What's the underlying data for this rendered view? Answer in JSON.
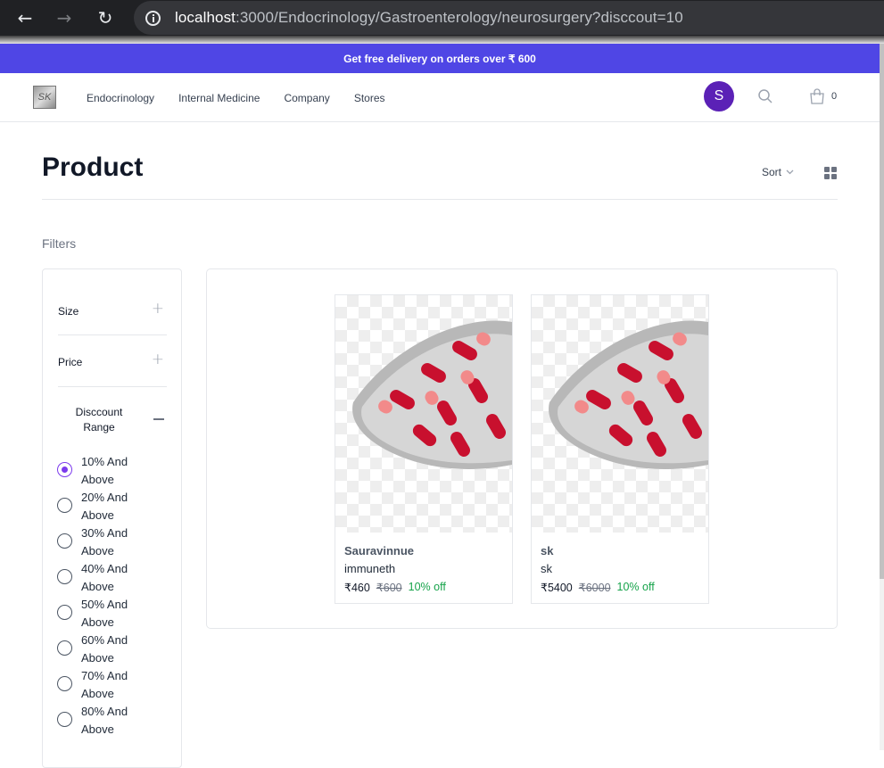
{
  "browser": {
    "url_host": "localhost",
    "url_path": ":3000/Endocrinology/Gastroenterology/neurosurgery?disccout=10"
  },
  "promo": {
    "text": "Get free delivery on orders over ₹ 600"
  },
  "header": {
    "logo_text": "SK",
    "nav": [
      "Endocrinology",
      "Internal Medicine",
      "Company",
      "Stores"
    ],
    "avatar_initial": "S",
    "cart_count": "0"
  },
  "page": {
    "title": "Product",
    "sort_label": "Sort",
    "filters_label": "Filters"
  },
  "filters": {
    "sections": [
      "Size",
      "Price"
    ],
    "discount_heading": "Disccount Range",
    "discount_options": [
      {
        "label": "10% And Above",
        "checked": true
      },
      {
        "label": "20% And Above",
        "checked": false
      },
      {
        "label": "30% And Above",
        "checked": false
      },
      {
        "label": "40% And Above",
        "checked": false
      },
      {
        "label": "50% And Above",
        "checked": false
      },
      {
        "label": "60% And Above",
        "checked": false
      },
      {
        "label": "70% And Above",
        "checked": false
      },
      {
        "label": "80% And Above",
        "checked": false
      }
    ]
  },
  "products": [
    {
      "name": "Sauravinnue",
      "subtitle": "immuneth",
      "price": "₹460",
      "mrp": "₹600",
      "discount": "10% off"
    },
    {
      "name": "sk",
      "subtitle": "sk",
      "price": "₹5400",
      "mrp": "₹6000",
      "discount": "10% off"
    }
  ],
  "colors": {
    "promo_bg": "#4f46e5",
    "avatar_bg": "#5b21b6",
    "radio_checked": "#7c3aed",
    "discount_text": "#16a34a"
  }
}
